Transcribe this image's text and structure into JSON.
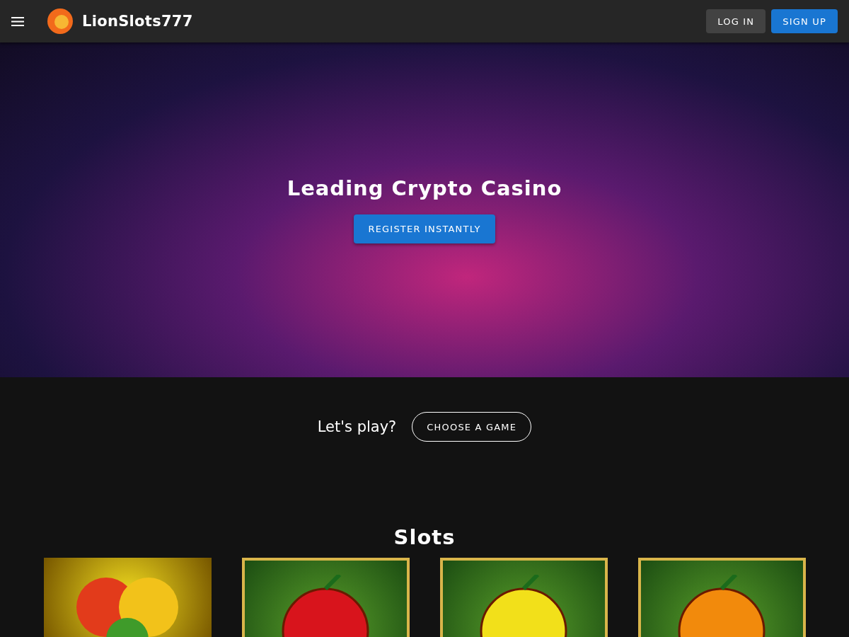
{
  "header": {
    "brand": "LionSlots777",
    "buttons": [
      {
        "label": "LOG IN",
        "kind": "secondary"
      },
      {
        "label": "SIGN UP",
        "kind": "primary"
      }
    ]
  },
  "hero": {
    "title": "Leading Crypto Casino",
    "button": "REGISTER INSTANTLY"
  },
  "play": {
    "prompt": "Let's play?",
    "button": "CHOOSE A GAME"
  },
  "slots": {
    "title": "Slots",
    "games": [
      {
        "kind": "clover"
      },
      {
        "kind": "fruit",
        "color": "#d8141c"
      },
      {
        "kind": "fruit",
        "color": "#f2e01a"
      },
      {
        "kind": "fruit",
        "color": "#f28a0c"
      }
    ]
  }
}
